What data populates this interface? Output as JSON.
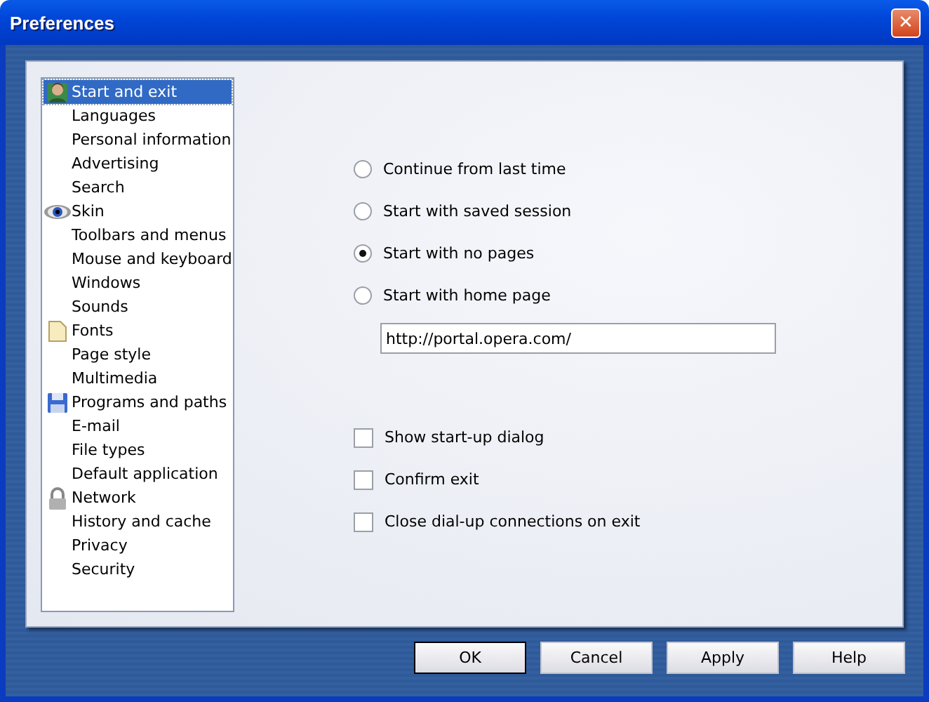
{
  "window": {
    "title": "Preferences",
    "close": "✕"
  },
  "sidebar": {
    "items": [
      {
        "label": "Start and exit",
        "selected": true,
        "kind": "person"
      },
      {
        "label": "Languages",
        "selected": false
      },
      {
        "label": "Personal information",
        "selected": false
      },
      {
        "label": "Advertising",
        "selected": false
      },
      {
        "label": "Search",
        "selected": false
      },
      {
        "label": "Skin",
        "selected": false,
        "kind": "eye"
      },
      {
        "label": "Toolbars and menus",
        "selected": false
      },
      {
        "label": "Mouse and keyboard",
        "selected": false
      },
      {
        "label": "Windows",
        "selected": false
      },
      {
        "label": "Sounds",
        "selected": false
      },
      {
        "label": "Fonts",
        "selected": false,
        "kind": "page"
      },
      {
        "label": "Page style",
        "selected": false
      },
      {
        "label": "Multimedia",
        "selected": false
      },
      {
        "label": "Programs and paths",
        "selected": false,
        "kind": "disk"
      },
      {
        "label": "E-mail",
        "selected": false
      },
      {
        "label": "File types",
        "selected": false
      },
      {
        "label": "Default application",
        "selected": false
      },
      {
        "label": "Network",
        "selected": false,
        "kind": "lock"
      },
      {
        "label": "History and cache",
        "selected": false
      },
      {
        "label": "Privacy",
        "selected": false
      },
      {
        "label": "Security",
        "selected": false
      }
    ]
  },
  "startup": [
    {
      "label": "Continue from last time",
      "selected": false
    },
    {
      "label": "Start with saved session",
      "selected": false
    },
    {
      "label": "Start with no pages",
      "selected": true
    },
    {
      "label": "Start with home page",
      "selected": false
    }
  ],
  "home_page": {
    "value": "http://portal.opera.com/"
  },
  "options": [
    {
      "label": "Show start-up dialog",
      "checked": false
    },
    {
      "label": "Confirm exit",
      "checked": false
    },
    {
      "label": "Close dial-up connections on exit",
      "checked": false
    }
  ],
  "buttons": [
    {
      "label": "OK",
      "default": true
    },
    {
      "label": "Cancel",
      "default": false
    },
    {
      "label": "Apply",
      "default": false
    },
    {
      "label": "Help",
      "default": false
    }
  ]
}
